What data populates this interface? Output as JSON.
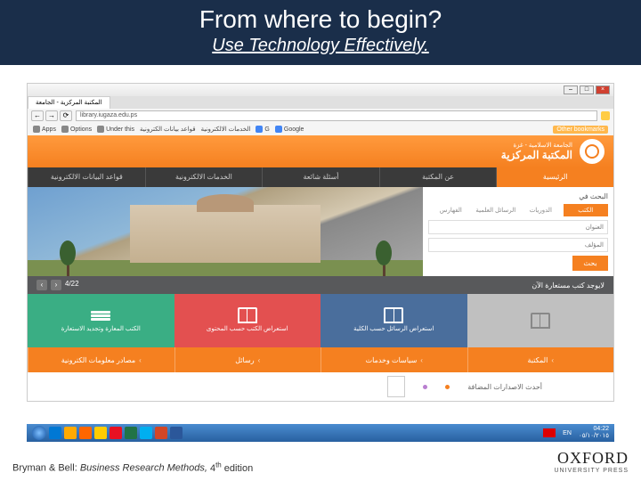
{
  "slide": {
    "title": "From where to begin?",
    "subtitle": "Use Technology Effectively."
  },
  "browser": {
    "tab_title": "المكتبة المركزية - الجامعة",
    "url": "library.iugaza.edu.ps",
    "bookmarks": {
      "apps": "Apps",
      "options": "Options",
      "underthis": "Under this",
      "g1": "Google",
      "g2": "G",
      "ar1": "الخدمات الالكترونية",
      "ar2": "قواعد بيانات الكترونية",
      "other": "Other bookmarks"
    }
  },
  "site": {
    "uni_name": "الجامعة الاسلامية - غزة",
    "lib_title": "المكتبة المركزية",
    "nav": [
      "الرئيسية",
      "عن المكتبة",
      "أسئلة شائعة",
      "الخدمات الالكترونية",
      "قواعد البيانات الالكترونية"
    ],
    "search_label": "البحث في",
    "sub_tabs": [
      "الكتب",
      "الدوريات",
      "الرسائل العلمية",
      "الفهارس"
    ],
    "field_title": "العنوان",
    "field_author": "المؤلف",
    "search_btn": "بحث",
    "strip_text": "لايوجد كتب مستعارة الآن",
    "strip_count": "4/22",
    "tiles": [
      "الكتب المعارة وتجديد الاستعارة",
      "استعراض الكتب حسب المحتوى",
      "استعراض الرسائل حسب الكلية",
      ""
    ],
    "footer_tiles": [
      "المكتبة",
      "سياسات وخدمات",
      "رسائل",
      "مصادر معلومات الكترونية"
    ],
    "latest_label": "أحدث الاصدارات المضافة"
  },
  "taskbar": {
    "lang": "EN",
    "time": "04:22",
    "date": "٠٥/١٠/٢٠١٥"
  },
  "citation": {
    "authors": "Bryman & Bell: ",
    "title": "Business Research Methods, ",
    "edition_num": "4",
    "edition_suffix": "th",
    "edition_word": " edition"
  },
  "publisher": {
    "name": "OXFORD",
    "tag": "UNIVERSITY PRESS"
  }
}
